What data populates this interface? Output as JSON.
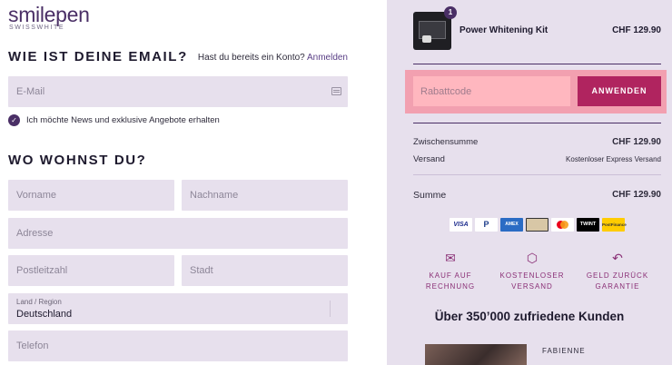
{
  "brand": {
    "name": "smilepen",
    "tagline": "SWISSWHITE"
  },
  "email_section": {
    "title": "WIE IST DEINE EMAIL?",
    "login_prompt": "Hast du bereits ein Konto?",
    "login_link": "Anmelden",
    "email_placeholder": "E-Mail",
    "newsletter_label": "Ich möchte News und exklusive Angebote erhalten",
    "newsletter_checked": true
  },
  "address_section": {
    "title": "WO WOHNST DU?",
    "first_name_placeholder": "Vorname",
    "last_name_placeholder": "Nachname",
    "address_placeholder": "Adresse",
    "zip_placeholder": "Postleitzahl",
    "city_placeholder": "Stadt",
    "country_label": "Land / Region",
    "country_value": "Deutschland",
    "phone_placeholder": "Telefon"
  },
  "cart": {
    "item": {
      "name": "Power Whitening Kit",
      "price": "CHF 129.90",
      "quantity": "1"
    },
    "discount_placeholder": "Rabattcode",
    "apply_label": "ANWENDEN",
    "subtotal_label": "Zwischensumme",
    "subtotal_value": "CHF 129.90",
    "shipping_label": "Versand",
    "shipping_value": "Kostenloser Express Versand",
    "total_label": "Summe",
    "total_value": "CHF 129.90"
  },
  "payment_methods": [
    "VISA",
    "P",
    "AMEX",
    "",
    "",
    "TWINT",
    "PostFinance"
  ],
  "features": [
    {
      "icon": "envelope-icon",
      "line1": "KAUF AUF",
      "line2": "RECHNUNG"
    },
    {
      "icon": "box-icon",
      "line1": "KOSTENLOSER",
      "line2": "VERSAND"
    },
    {
      "icon": "return-icon",
      "line1": "GELD ZURÜCK",
      "line2": "GARANTIE"
    }
  ],
  "social_proof": {
    "headline": "Über 350’000 zufriedene Kunden",
    "reviewer": "FABIENNE"
  },
  "colors": {
    "brand_purple": "#4a2f66",
    "field_bg": "#e7e0ed",
    "apply_button": "#b0245f",
    "discount_highlight": "#f2a0b0",
    "feature_accent": "#8a2f76"
  }
}
